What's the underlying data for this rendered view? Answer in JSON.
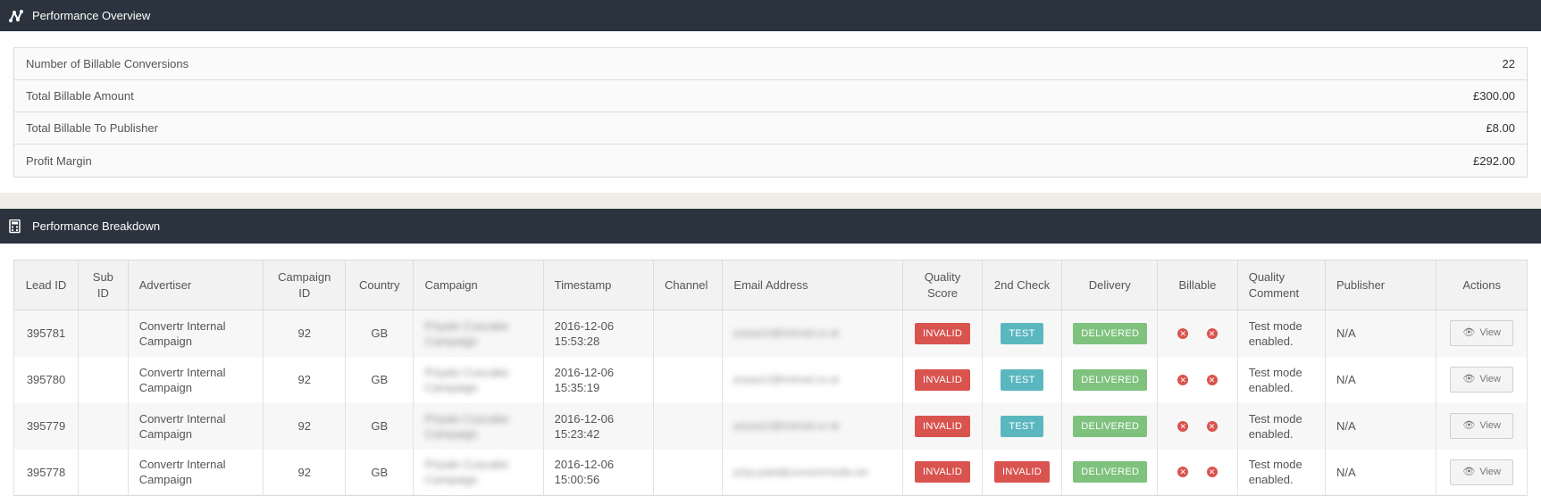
{
  "overview": {
    "title": "Performance Overview",
    "icon": "chart-line-icon",
    "rows": [
      {
        "label": "Number of Billable Conversions",
        "value": "22"
      },
      {
        "label": "Total Billable Amount",
        "value": "£300.00"
      },
      {
        "label": "Total Billable To Publisher",
        "value": "£8.00"
      },
      {
        "label": "Profit Margin",
        "value": "£292.00"
      }
    ]
  },
  "breakdown": {
    "title": "Performance Breakdown",
    "icon": "calculator-icon",
    "columns": {
      "lead_id": "Lead ID",
      "sub_id": "Sub ID",
      "advertiser": "Advertiser",
      "campaign_id": "Campaign ID",
      "country": "Country",
      "campaign": "Campaign",
      "timestamp": "Timestamp",
      "channel": "Channel",
      "email": "Email Address",
      "quality_score": "Quality Score",
      "second_check": "2nd Check",
      "delivery": "Delivery",
      "billable": "Billable",
      "quality_comment": "Quality Comment",
      "publisher": "Publisher",
      "actions": "Actions"
    },
    "rows": [
      {
        "lead_id": "395781",
        "sub_id": "",
        "advertiser": "Convertr Internal Campaign",
        "campaign_id": "92",
        "country": "GB",
        "campaign": "Priyalo Cuscake Campaign",
        "timestamp": "2016-12-06 15:53:28",
        "channel": "",
        "email": "priyaa12@hotmail.co.uk",
        "quality_score": "INVALID",
        "second_check": "TEST",
        "delivery": "DELIVERED",
        "quality_comment": "Test mode enabled.",
        "publisher": "N/A",
        "action": "View"
      },
      {
        "lead_id": "395780",
        "sub_id": "",
        "advertiser": "Convertr Internal Campaign",
        "campaign_id": "92",
        "country": "GB",
        "campaign": "Priyalo Cuscake Campaign",
        "timestamp": "2016-12-06 15:35:19",
        "channel": "",
        "email": "priyaa12@hotmail.co.uk",
        "quality_score": "INVALID",
        "second_check": "TEST",
        "delivery": "DELIVERED",
        "quality_comment": "Test mode enabled.",
        "publisher": "N/A",
        "action": "View"
      },
      {
        "lead_id": "395779",
        "sub_id": "",
        "advertiser": "Convertr Internal Campaign",
        "campaign_id": "92",
        "country": "GB",
        "campaign": "Priyalo Cuscake Campaign",
        "timestamp": "2016-12-06 15:23:42",
        "channel": "",
        "email": "priyaa12@hotmail.co.uk",
        "quality_score": "INVALID",
        "second_check": "TEST",
        "delivery": "DELIVERED",
        "quality_comment": "Test mode enabled.",
        "publisher": "N/A",
        "action": "View"
      },
      {
        "lead_id": "395778",
        "sub_id": "",
        "advertiser": "Convertr Internal Campaign",
        "campaign_id": "92",
        "country": "GB",
        "campaign": "Priyalo Cuscake Campaign",
        "timestamp": "2016-12-06 15:00:56",
        "channel": "",
        "email": "priya.patel@convertrmedia.net",
        "quality_score": "INVALID",
        "second_check": "INVALID",
        "delivery": "DELIVERED",
        "quality_comment": "Test mode enabled.",
        "publisher": "N/A",
        "action": "View"
      }
    ]
  },
  "colors": {
    "header_bg": "#2a333e",
    "invalid": "#d9534f",
    "test": "#5bb7bf",
    "delivered": "#7ec27e"
  }
}
